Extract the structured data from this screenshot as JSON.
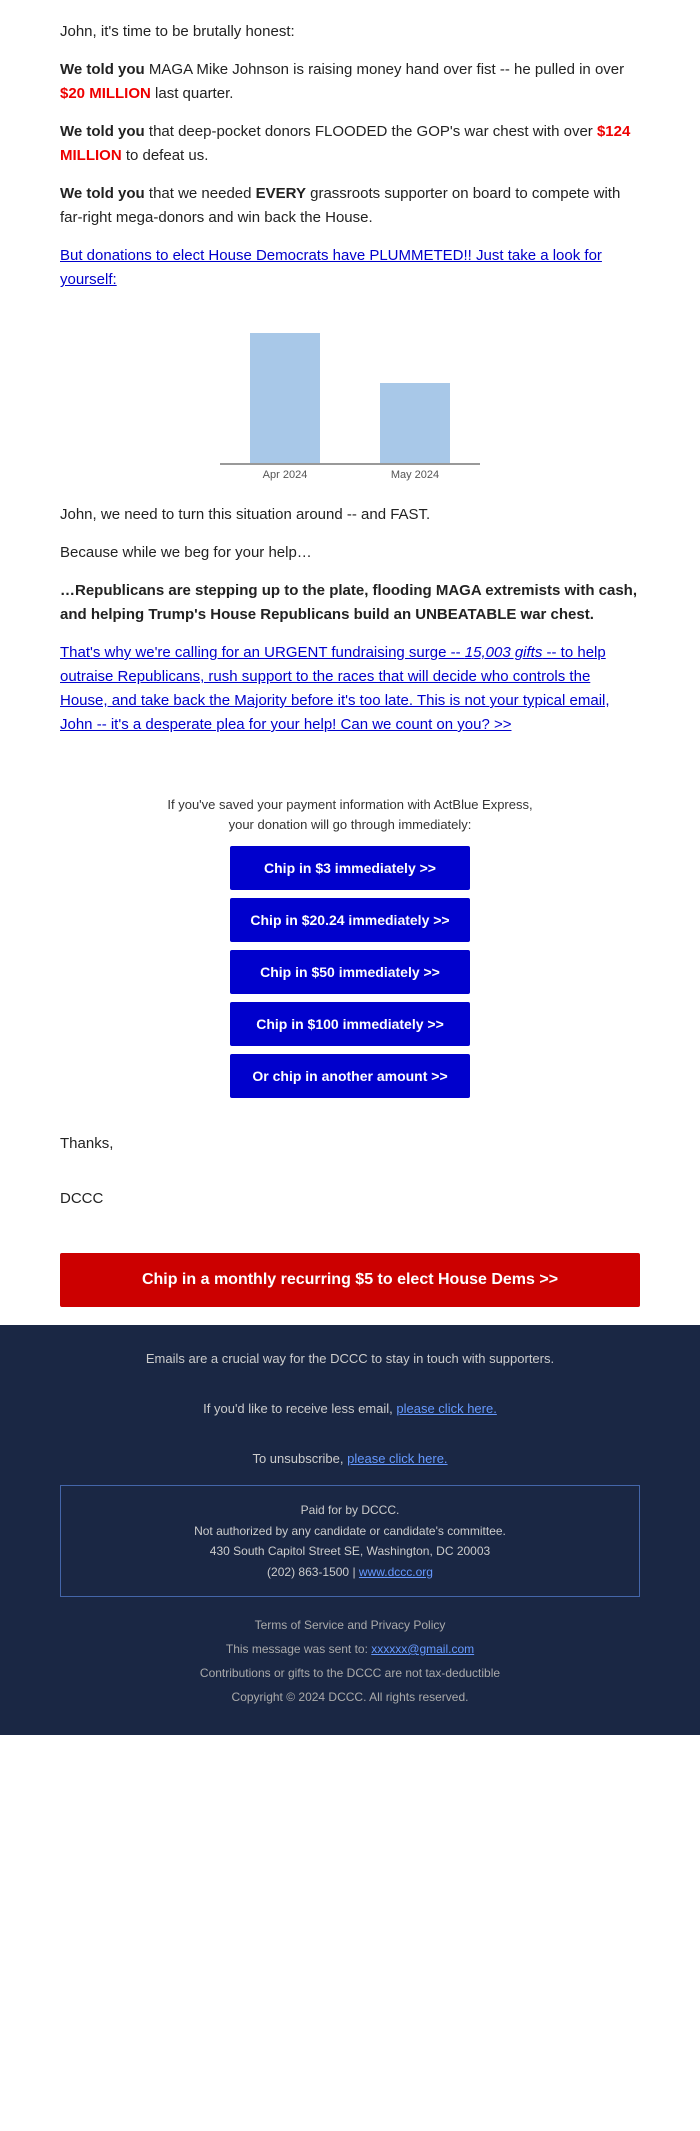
{
  "intro": {
    "greeting": "John, it's time to be brutally honest:"
  },
  "paragraphs": [
    {
      "id": "p1",
      "bold_prefix": "We told you",
      "text": " MAGA Mike Johnson is raising money hand over fist -- he pulled in over ",
      "highlight": "$20 MILLION",
      "suffix": " last quarter."
    },
    {
      "id": "p2",
      "bold_prefix": "We told you",
      "text": " that deep-pocket donors FLOODED the GOP's war chest with over ",
      "highlight": "$124 MILLION",
      "suffix": " to defeat us."
    },
    {
      "id": "p3",
      "bold_prefix": "We told you",
      "text": " that we needed ",
      "highlight2": "EVERY",
      "suffix": " grassroots supporter on board to compete with far-right mega-donors and win back the House."
    }
  ],
  "link1": {
    "text": "But donations to elect House Democrats have PLUMMETED!! Just take a look for yourself:"
  },
  "chart": {
    "bar1_label": "Apr 2024",
    "bar2_label": "May 2024"
  },
  "p4": "John, we need to turn this situation around -- and FAST.",
  "p5": "Because while we beg for your help…",
  "p6_bold": "…Republicans are stepping up to the plate, flooding MAGA extremists with cash, and helping Trump's House Republicans build an UNBEATABLE war chest.",
  "link2": {
    "text": "That's why we're calling for an URGENT fundraising surge -- 15,003 gifts -- to help outraise Republicans, rush support to the races that will decide who controls the House, and take back the Majority before it's too late. This is not your typical email, John -- it's a desperate plea for your help! Can we count on you? >>"
  },
  "actblue_note": "If you've saved your payment information with ActBlue Express,\nyour donation will go through immediately:",
  "buttons": [
    {
      "id": "btn1",
      "label": "Chip in $3 immediately >>"
    },
    {
      "id": "btn2",
      "label": "Chip in $20.24 immediately >>"
    },
    {
      "id": "btn3",
      "label": "Chip in $50 immediately >>"
    },
    {
      "id": "btn4",
      "label": "Chip in $100 immediately >>"
    },
    {
      "id": "btn5",
      "label": "Or chip in another amount >>"
    }
  ],
  "sign_off": {
    "thanks": "Thanks,",
    "org": "DCCC"
  },
  "monthly_btn": {
    "label": "Chip in a monthly recurring $5 to elect House Dems >>"
  },
  "footer": {
    "line1": "Emails are a crucial way for the DCCC to stay in touch with supporters.",
    "line2_prefix": "If you'd like to receive less email, ",
    "link_less": "please click here.",
    "line3_prefix": "To unsubscribe, ",
    "link_unsub": "please click here.",
    "box": {
      "line1": "Paid for by DCCC.",
      "line2": "Not authorized by any candidate or candidate's committee.",
      "line3": "430 South Capitol Street SE, Washington, DC 20003",
      "line4_prefix": "(202) 863-1500 | ",
      "link_dccc": "www.dccc.org"
    },
    "tos": "Terms of Service and Privacy Policy",
    "sent_to_prefix": "This message was sent to: ",
    "email": "xxxxxx@gmail.com",
    "not_deductible": "Contributions or gifts to the DCCC are not tax-deductible",
    "copyright": "Copyright © 2024 DCCC. All rights reserved."
  }
}
